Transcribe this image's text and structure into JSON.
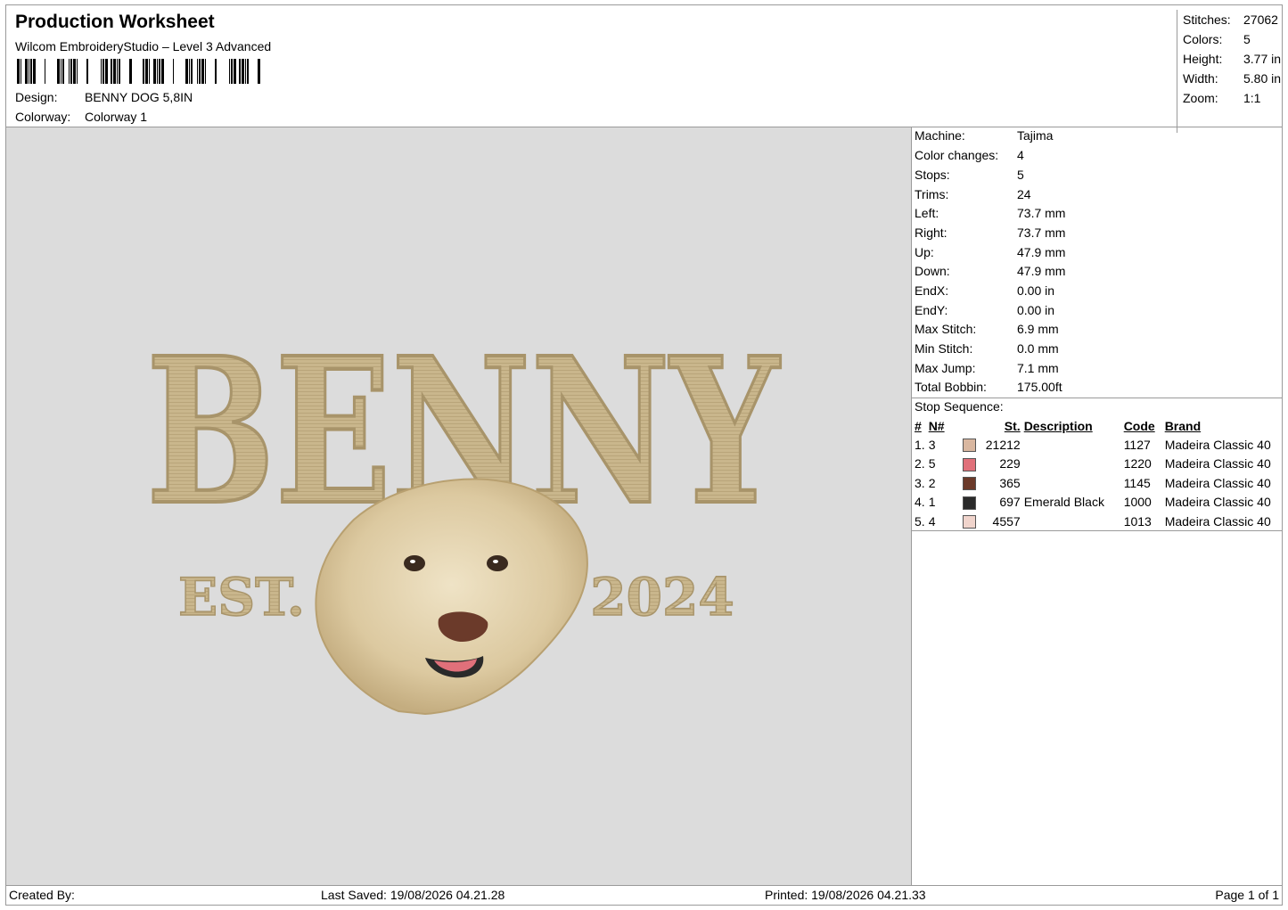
{
  "header": {
    "title": "Production Worksheet",
    "subtitle": "Wilcom EmbroideryStudio – Level 3 Advanced",
    "design_label": "Design:",
    "design_value": "BENNY DOG 5,8IN",
    "colorway_label": "Colorway:",
    "colorway_value": "Colorway 1"
  },
  "stats": [
    {
      "label": "Stitches:",
      "value": "27062"
    },
    {
      "label": "Colors:",
      "value": "5"
    },
    {
      "label": "Height:",
      "value": "3.77 in"
    },
    {
      "label": "Width:",
      "value": "5.80 in"
    },
    {
      "label": "Zoom:",
      "value": "1:1"
    }
  ],
  "design": {
    "main_text": "BENNY",
    "left_text": "EST.",
    "right_text": "2024",
    "thread_color": "#c9b68c",
    "bg_color": "#dcdcdc"
  },
  "properties": [
    {
      "label": "Machine:",
      "value": "Tajima"
    },
    {
      "label": "Color changes:",
      "value": "4"
    },
    {
      "label": "Stops:",
      "value": "5"
    },
    {
      "label": "Trims:",
      "value": "24"
    },
    {
      "label": "Left:",
      "value": "73.7 mm"
    },
    {
      "label": "Right:",
      "value": "73.7 mm"
    },
    {
      "label": "Up:",
      "value": "47.9 mm"
    },
    {
      "label": "Down:",
      "value": "47.9 mm"
    },
    {
      "label": "EndX:",
      "value": "0.00 in"
    },
    {
      "label": "EndY:",
      "value": "0.00 in"
    },
    {
      "label": "Max Stitch:",
      "value": "6.9 mm"
    },
    {
      "label": "Min Stitch:",
      "value": "0.0 mm"
    },
    {
      "label": "Max Jump:",
      "value": "7.1 mm"
    },
    {
      "label": "Total Bobbin:",
      "value": "175.00ft"
    }
  ],
  "stop_sequence": {
    "title": "Stop Sequence:",
    "headers": {
      "idx": "#",
      "n": "N#",
      "st": "St.",
      "desc": "Description",
      "code": "Code",
      "brand": "Brand"
    },
    "rows": [
      {
        "idx": "1.",
        "n": "3",
        "color": "#d9b7a0",
        "st": "21212",
        "desc": "",
        "code": "1127",
        "brand": "Madeira Classic 40"
      },
      {
        "idx": "2.",
        "n": "5",
        "color": "#e0707a",
        "st": "229",
        "desc": "",
        "code": "1220",
        "brand": "Madeira Classic 40"
      },
      {
        "idx": "3.",
        "n": "2",
        "color": "#6b3a2a",
        "st": "365",
        "desc": "",
        "code": "1145",
        "brand": "Madeira Classic 40"
      },
      {
        "idx": "4.",
        "n": "1",
        "color": "#2a2a2a",
        "st": "697",
        "desc": "Emerald Black",
        "code": "1000",
        "brand": "Madeira Classic 40"
      },
      {
        "idx": "5.",
        "n": "4",
        "color": "#f0d4cc",
        "st": "4557",
        "desc": "",
        "code": "1013",
        "brand": "Madeira Classic 40"
      }
    ]
  },
  "footer": {
    "created_by": "Created By:",
    "last_saved": "Last Saved: 19/08/2026 04.21.28",
    "printed": "Printed: 19/08/2026 04.21.33",
    "page": "Page 1 of 1"
  }
}
